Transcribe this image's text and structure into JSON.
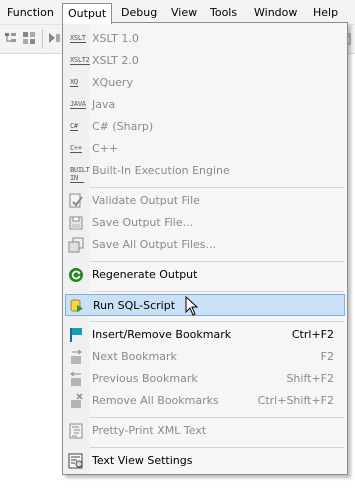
{
  "menubar": {
    "items": [
      {
        "label": "Function"
      },
      {
        "label": "Output"
      },
      {
        "label": "Debug"
      },
      {
        "label": "View"
      },
      {
        "label": "Tools"
      },
      {
        "label": "Window"
      },
      {
        "label": "Help"
      }
    ],
    "active": "Output"
  },
  "menu": {
    "items": [
      {
        "label": "XSLT 1.0",
        "tag": "XSLT",
        "enabled": false
      },
      {
        "label": "XSLT 2.0",
        "tag": "XSLT2",
        "enabled": false
      },
      {
        "label": "XQuery",
        "tag": "XQ",
        "enabled": false
      },
      {
        "label": "Java",
        "tag": "JAVA",
        "enabled": false
      },
      {
        "label": "C# (Sharp)",
        "tag": "C#",
        "enabled": false
      },
      {
        "label": "C++",
        "tag": "C++",
        "enabled": false
      },
      {
        "label": "Built-In Execution Engine",
        "tag": "BUILT IN",
        "enabled": false
      },
      {
        "label": "Validate Output File",
        "enabled": false
      },
      {
        "label": "Save Output File...",
        "enabled": false
      },
      {
        "label": "Save All Output Files...",
        "enabled": false
      },
      {
        "label": "Regenerate Output",
        "enabled": true
      },
      {
        "label": "Run SQL-Script",
        "enabled": true,
        "highlighted": true
      },
      {
        "label": "Insert/Remove Bookmark",
        "shortcut": "Ctrl+F2",
        "enabled": true
      },
      {
        "label": "Next Bookmark",
        "shortcut": "F2",
        "enabled": false
      },
      {
        "label": "Previous Bookmark",
        "shortcut": "Shift+F2",
        "enabled": false
      },
      {
        "label": "Remove All Bookmarks",
        "shortcut": "Ctrl+Shift+F2",
        "enabled": false
      },
      {
        "label": "Pretty-Print XML Text",
        "enabled": false
      },
      {
        "label": "Text View Settings",
        "enabled": true
      }
    ]
  },
  "colors": {
    "highlight_bg": "#c9e0f7",
    "highlight_border": "#7cb0e1",
    "regenerate_green": "#1e8a1e",
    "bookmark_teal": "#10a0b0"
  }
}
